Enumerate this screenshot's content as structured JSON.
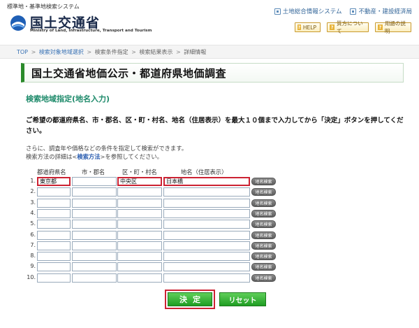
{
  "header": {
    "system_title": "標準地・基準地検索システム",
    "logo_text": "国土交通省",
    "logo_en": "Ministry of Land, Infrastructure, Transport and Tourism",
    "ext_links": [
      {
        "label": "土地総合情報システム",
        "icon": "window-icon"
      },
      {
        "label": "不動産・建設経済局",
        "icon": "window-icon"
      }
    ],
    "help_buttons": [
      {
        "label": "HELP",
        "icon": "question-icon"
      },
      {
        "label": "質方について",
        "icon": "question-icon"
      },
      {
        "label": "用語の説明",
        "icon": "question-icon"
      }
    ]
  },
  "breadcrumb": {
    "items": [
      {
        "label": "TOP",
        "link": true
      },
      {
        "label": "検索対象地域選択",
        "link": true
      },
      {
        "label": "検索条件指定",
        "link": false
      },
      {
        "label": "検索結果表示",
        "link": false
      },
      {
        "label": "詳細情報",
        "link": false
      }
    ],
    "separator": ">"
  },
  "page_title": "国土交通省地価公示・都道府県地価調査",
  "section_title": "検索地域指定(地名入力)",
  "instruction": "ご希望の都道府県名、市・郡名、区・町・村名、地名（住居表示）を最大１０個まで入力してから「決定」ボタンを押してください。",
  "note": {
    "line1": "さらに、調査年や価格などの条件を指定して検索ができます。",
    "line2_prefix": "検索方法の詳細は<",
    "line2_link": "検索方法",
    "line2_suffix": ">を参照してください。"
  },
  "table": {
    "headers": [
      "都道府県名",
      "市・郡名",
      "区・町・村名",
      "地名（住居表示）"
    ],
    "lookup_label": "地名検索",
    "rows": [
      {
        "num": "1.",
        "pref": "東京都",
        "city": "",
        "ward": "中央区",
        "place": "日本橋"
      },
      {
        "num": "2.",
        "pref": "",
        "city": "",
        "ward": "",
        "place": ""
      },
      {
        "num": "3.",
        "pref": "",
        "city": "",
        "ward": "",
        "place": ""
      },
      {
        "num": "4.",
        "pref": "",
        "city": "",
        "ward": "",
        "place": ""
      },
      {
        "num": "5.",
        "pref": "",
        "city": "",
        "ward": "",
        "place": ""
      },
      {
        "num": "6.",
        "pref": "",
        "city": "",
        "ward": "",
        "place": ""
      },
      {
        "num": "7.",
        "pref": "",
        "city": "",
        "ward": "",
        "place": ""
      },
      {
        "num": "8.",
        "pref": "",
        "city": "",
        "ward": "",
        "place": ""
      },
      {
        "num": "9.",
        "pref": "",
        "city": "",
        "ward": "",
        "place": ""
      },
      {
        "num": "10.",
        "pref": "",
        "city": "",
        "ward": "",
        "place": ""
      }
    ]
  },
  "buttons": {
    "decide": "決定",
    "reset": "リセット"
  },
  "colors": {
    "accent_green": "#2a8a2a",
    "section_title": "#1d8a6a",
    "highlight_red": "#cc2233",
    "link_blue": "#3a73b5"
  }
}
